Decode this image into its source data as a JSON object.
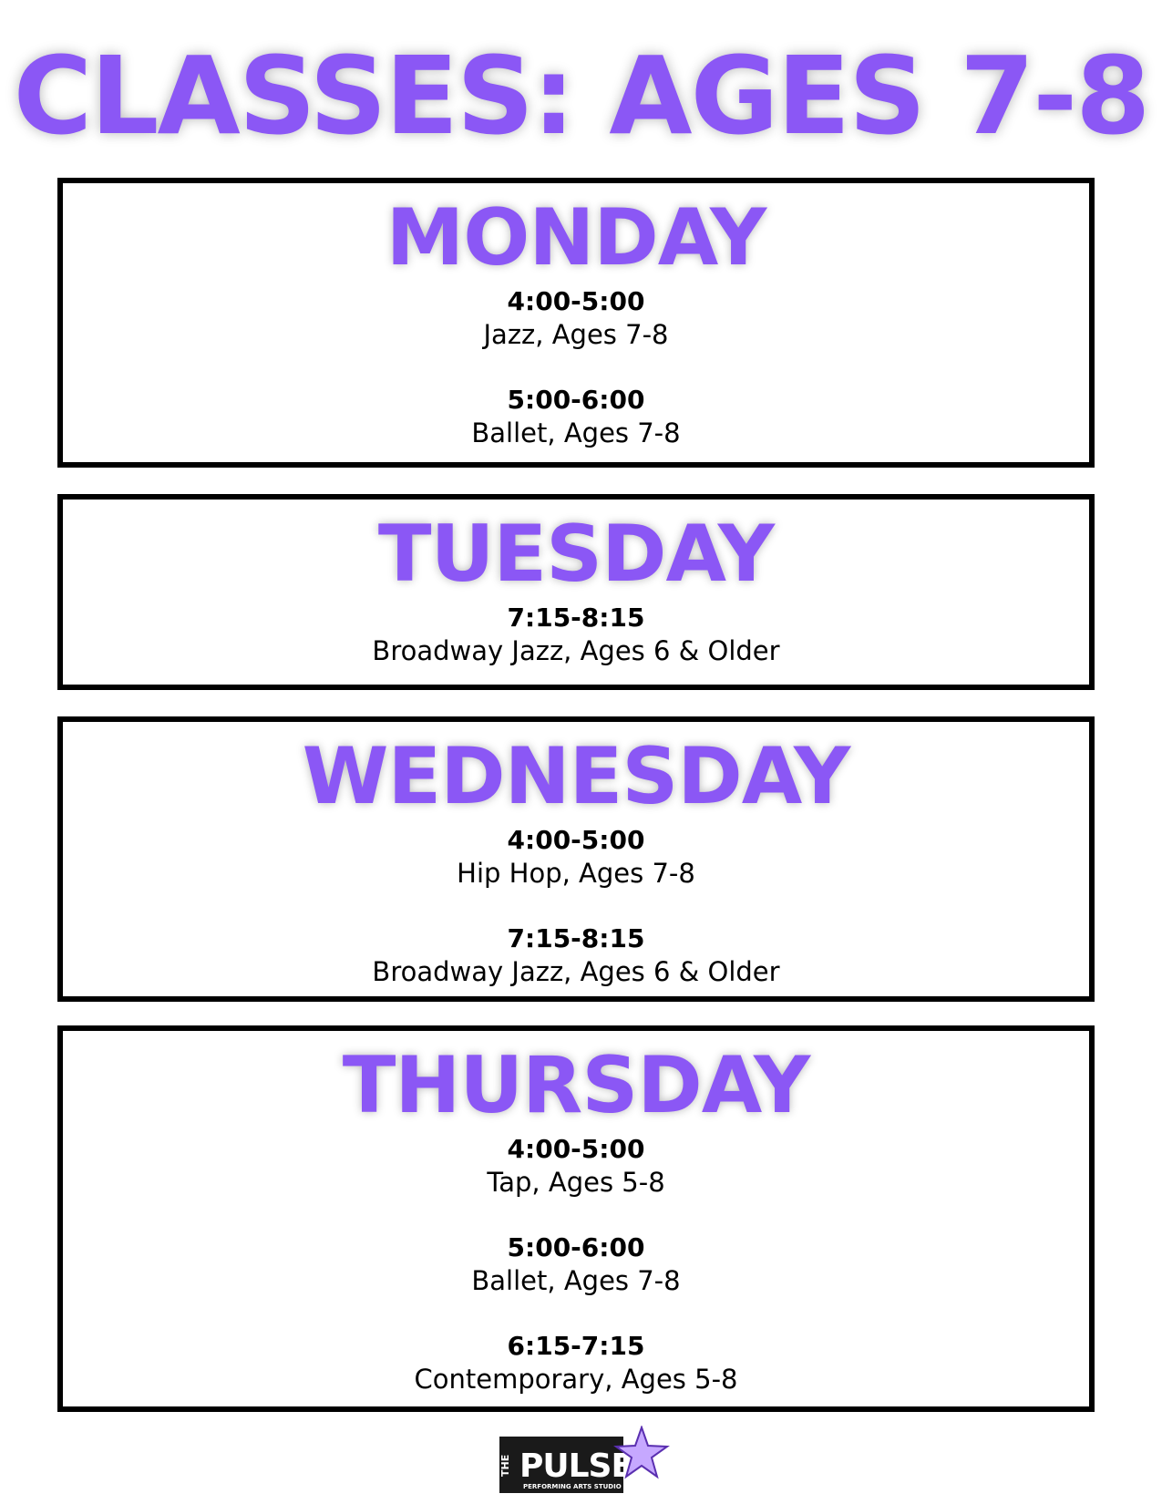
{
  "colors": {
    "accent": "#8b57f5",
    "border": "#000000",
    "background": "#ffffff"
  },
  "title": "CLASSES: AGES 7-8",
  "days": [
    {
      "name": "MONDAY",
      "sessions": [
        {
          "time": "4:00-5:00",
          "desc": "Jazz, Ages 7-8"
        },
        {
          "time": "5:00-6:00",
          "desc": "Ballet, Ages 7-8"
        }
      ]
    },
    {
      "name": "TUESDAY",
      "sessions": [
        {
          "time": "7:15-8:15",
          "desc": "Broadway Jazz, Ages 6 & Older"
        }
      ]
    },
    {
      "name": "WEDNESDAY",
      "sessions": [
        {
          "time": "4:00-5:00",
          "desc": "Hip Hop, Ages 7-8"
        },
        {
          "time": "7:15-8:15",
          "desc": "Broadway Jazz, Ages 6 & Older"
        }
      ]
    },
    {
      "name": "THURSDAY",
      "sessions": [
        {
          "time": "4:00-5:00",
          "desc": "Tap, Ages 5-8"
        },
        {
          "time": "5:00-6:00",
          "desc": "Ballet, Ages 7-8"
        },
        {
          "time": "6:15-7:15",
          "desc": "Contemporary, Ages 5-8"
        }
      ]
    }
  ],
  "logo": {
    "prefix": "THE",
    "name": "PULSE",
    "tagline": "PERFORMING ARTS STUDIO",
    "icon": "star-icon"
  }
}
